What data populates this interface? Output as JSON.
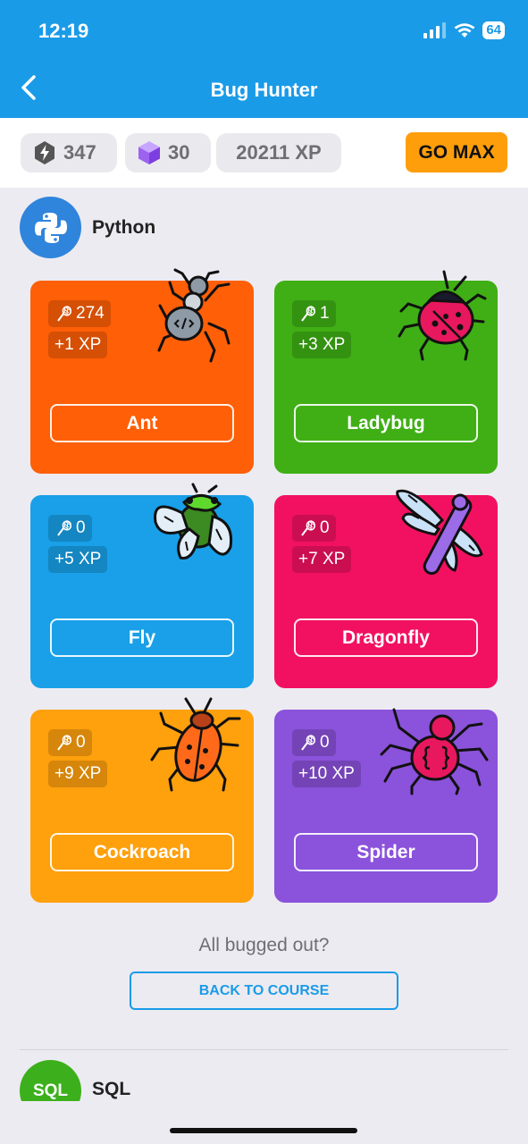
{
  "status_bar": {
    "time": "12:19",
    "battery": "64"
  },
  "nav": {
    "title": "Bug Hunter"
  },
  "stats": {
    "bolts": "347",
    "gems": "30",
    "xp": "20211 XP",
    "go_max": "GO MAX"
  },
  "section": {
    "language": "Python"
  },
  "colors": {
    "header": "#1a9be8",
    "ant": "#fe5f07",
    "ladybug": "#3faf15",
    "fly": "#19a0e8",
    "dragonfly": "#f21160",
    "cockroach": "#ffa00d",
    "spider": "#8b52db"
  },
  "bugs": [
    {
      "name": "Ant",
      "count": "274",
      "xp": "+1 XP",
      "icon": "ant-icon"
    },
    {
      "name": "Ladybug",
      "count": "1",
      "xp": "+3 XP",
      "icon": "ladybug-icon"
    },
    {
      "name": "Fly",
      "count": "0",
      "xp": "+5 XP",
      "icon": "fly-icon"
    },
    {
      "name": "Dragonfly",
      "count": "0",
      "xp": "+7 XP",
      "icon": "dragonfly-icon"
    },
    {
      "name": "Cockroach",
      "count": "0",
      "xp": "+9 XP",
      "icon": "cockroach-icon"
    },
    {
      "name": "Spider",
      "count": "0",
      "xp": "+10 XP",
      "icon": "spider-icon"
    }
  ],
  "footer": {
    "question": "All bugged out?",
    "back_button": "BACK TO COURSE"
  },
  "next_section": {
    "logo": "SQL",
    "name": "SQL"
  }
}
